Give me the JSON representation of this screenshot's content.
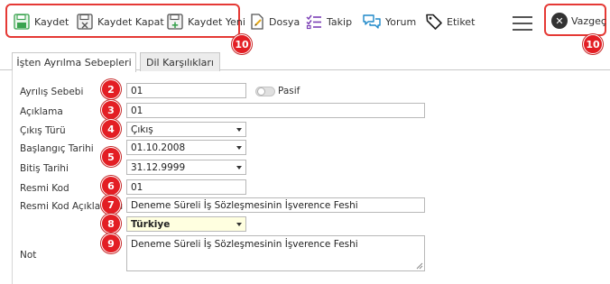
{
  "toolbar": {
    "save_label": "Kaydet",
    "save_close_label": "Kaydet Kapat",
    "save_new_label": "Kaydet Yeni",
    "file_label": "Dosya",
    "follow_label": "Takip",
    "comment_label": "Yorum",
    "tag_label": "Etiket",
    "cancel_label": "Vazgeç"
  },
  "tabs": [
    {
      "label": "İşten Ayrılma Sebepleri",
      "active": true
    },
    {
      "label": "Dil Karşılıkları",
      "active": false
    }
  ],
  "form": {
    "reason_label": "Ayrılış Sebebi",
    "reason_value": "01",
    "passive_label": "Pasif",
    "description_label": "Açıklama",
    "description_value": "01",
    "exit_type_label": "Çıkış Türü",
    "exit_type_value": "Çıkış",
    "start_date_label": "Başlangıç Tarihi",
    "start_date_value": "01.10.2008",
    "end_date_label": "Bitiş Tarihi",
    "end_date_value": "31.12.9999",
    "official_code_label": "Resmi Kod",
    "official_code_value": "01",
    "official_code_desc_label": "Resmi Kod Açıklaması",
    "official_code_desc_value": "Deneme Süreli İş Sözleşmesinin İşverence Feshi",
    "country_value": "Türkiye",
    "note_label": "Not",
    "note_value": "Deneme Süreli İş Sözleşmesinin İşverence Feshi"
  },
  "markers": [
    "2",
    "3",
    "4",
    "5",
    "6",
    "7",
    "8",
    "9",
    "10",
    "10"
  ],
  "colors": {
    "marker": "#e31e24",
    "highlight_box": "#e53935",
    "save_icon": "#3aa34f",
    "follow_icon": "#7b3fb5",
    "comment_icon": "#1e88c9",
    "country_bg": "#ffffe0"
  },
  "icons": [
    "save-icon",
    "save-close-icon",
    "save-new-icon",
    "file-icon",
    "follow-icon",
    "comment-icon",
    "tag-icon",
    "menu-icon",
    "cancel-icon"
  ]
}
